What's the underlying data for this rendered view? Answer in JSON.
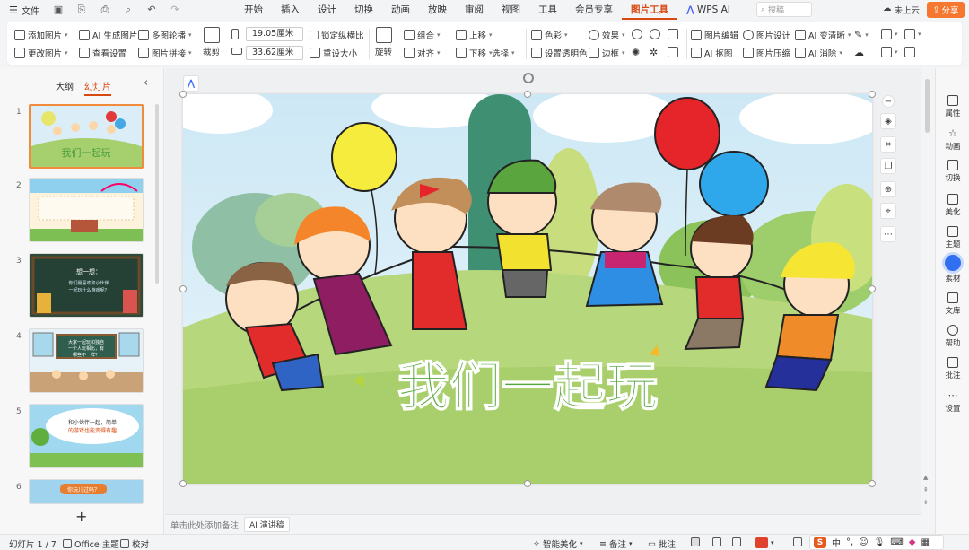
{
  "topbar": {
    "file_label": "文件",
    "tabs": [
      {
        "label": "开始"
      },
      {
        "label": "插入"
      },
      {
        "label": "设计"
      },
      {
        "label": "切换"
      },
      {
        "label": "动画"
      },
      {
        "label": "放映"
      },
      {
        "label": "审阅"
      },
      {
        "label": "视图"
      },
      {
        "label": "工具"
      },
      {
        "label": "会员专享"
      },
      {
        "label": "图片工具",
        "active": true
      }
    ],
    "wps_ai": "WPS AI",
    "search_placeholder": "搜稿",
    "cloud": "未上云",
    "share": "分享"
  },
  "ribbon": {
    "add_image": "添加图片",
    "ai_generate": "AI 生成图片",
    "multi_outline": "多图轮播",
    "change_image": "更改图片",
    "view_settings": "查看设置",
    "image_merge": "图片拼接",
    "crop": "裁剪",
    "height": "19.05厘米",
    "width": "33.62厘米",
    "lock_ratio": "锁定纵横比",
    "reset_size": "重设大小",
    "rotate": "旋转",
    "group": "组合",
    "align": "对齐",
    "move_up": "上移",
    "move_down": "下移",
    "select": "选择",
    "color": "色彩",
    "set_transparent": "设置透明色",
    "effect": "效果",
    "border": "边框",
    "image_edit": "图片编辑",
    "image_design": "图片设计",
    "ai_change_clear": "AI 变清晰",
    "ai_cutout": "AI 抠图",
    "image_compress": "图片压缩",
    "ai_remove": "AI 消除"
  },
  "leftpanel": {
    "tab_outline": "大纲",
    "tab_slides": "幻灯片",
    "slides": [
      {
        "num": "1",
        "title": "我们一起玩"
      },
      {
        "num": "2"
      },
      {
        "num": "3",
        "text": "想一想：\n你们最喜欢和小伙伴\n一起玩什么游戏呢？"
      },
      {
        "num": "4",
        "text": "大家一起玩和独自\n一个人玩相比，有\n哪些不一样？"
      },
      {
        "num": "5",
        "text": "和小伙伴一起，简单\n的游戏也能变得有趣"
      },
      {
        "num": "6",
        "text": "你玩儿过吗？"
      }
    ],
    "add": "+"
  },
  "slide": {
    "title": "我们一起玩"
  },
  "rightside": {
    "items": [
      {
        "label": "属性"
      },
      {
        "label": "动画"
      },
      {
        "label": "切换"
      },
      {
        "label": "美化"
      },
      {
        "label": "主题"
      },
      {
        "label": "素材"
      },
      {
        "label": "文库"
      },
      {
        "label": "帮助"
      },
      {
        "label": "批注"
      },
      {
        "label": "设置"
      }
    ]
  },
  "notes": {
    "hint": "单击此处添加备注",
    "ai_script": "AI 演讲稿"
  },
  "status": {
    "slide_count": "幻灯片 1 / 7",
    "theme": "Office 主题",
    "proof": "校对",
    "smart_beautify": "智能美化",
    "notes": "备注",
    "comments": "批注",
    "ime_chinese": "中"
  }
}
